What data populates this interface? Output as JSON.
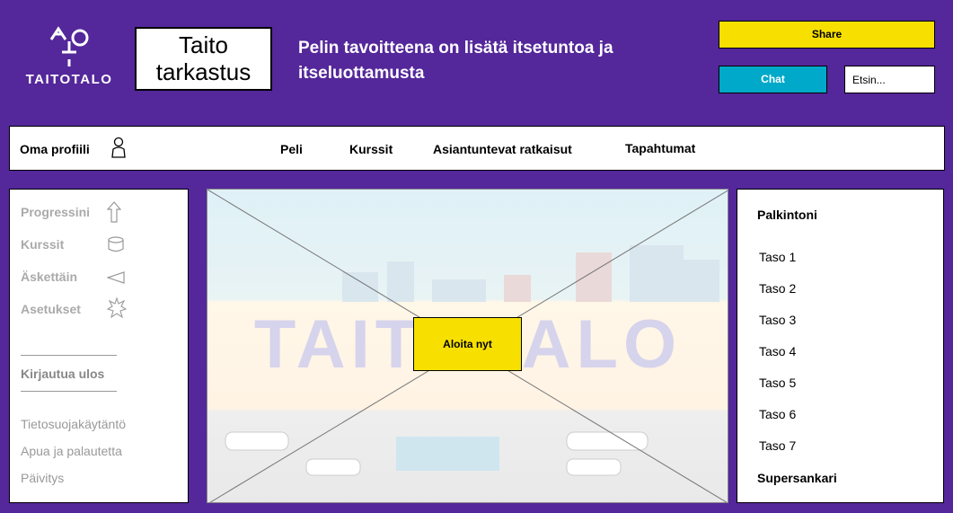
{
  "header": {
    "logo_text": "TAITOTALO",
    "title": "Taito tarkastus",
    "headline": "Pelin tavoitteena on lisätä itsetuntoa ja itseluottamusta",
    "share_label": "Share",
    "chat_label": "Chat",
    "search_placeholder": "Etsin..."
  },
  "nav": {
    "profile_label": "Oma profiili",
    "items": [
      "Peli",
      "Kurssit",
      "Asiantuntevat ratkaisut",
      "Tapahtumat"
    ]
  },
  "sidebar": {
    "items": [
      {
        "label": "Progressini",
        "icon": "arrow-up-icon"
      },
      {
        "label": "Kurssit",
        "icon": "database-icon"
      },
      {
        "label": "Äskettäin",
        "icon": "triangle-left-icon"
      },
      {
        "label": "Asetukset",
        "icon": "star-burst-icon"
      }
    ],
    "logout_label": "Kirjautua ulos",
    "links": [
      "Tietosuojakäytäntö",
      "Apua ja palautetta",
      "Päivitys"
    ]
  },
  "main": {
    "start_label": "Aloita nyt",
    "watermark": "TAITOTALO"
  },
  "rewards": {
    "title": "Palkintoni",
    "levels": [
      "Taso 1",
      "Taso 2",
      "Taso 3",
      "Taso 4",
      "Taso 5",
      "Taso 6",
      "Taso 7"
    ],
    "final": "Supersankari"
  }
}
